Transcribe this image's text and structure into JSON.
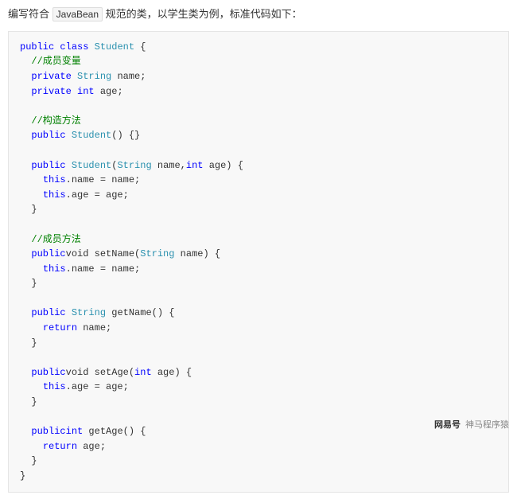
{
  "intro": {
    "prefix": "编写符合",
    "boxed": "JavaBean",
    "suffix": "规范的类，以学生类为例，标准代码如下："
  },
  "code": {
    "lines": [
      [
        {
          "t": "kw-public",
          "v": "public"
        },
        {
          "t": "",
          "v": " "
        },
        {
          "t": "kw-class",
          "v": "class"
        },
        {
          "t": "",
          "v": " "
        },
        {
          "t": "class-name",
          "v": "Student"
        },
        {
          "t": "",
          "v": " {"
        }
      ],
      [
        {
          "t": "",
          "v": "  "
        },
        {
          "t": "comment",
          "v": "//成员变量"
        }
      ],
      [
        {
          "t": "",
          "v": "  "
        },
        {
          "t": "kw-private",
          "v": "private"
        },
        {
          "t": "",
          "v": " "
        },
        {
          "t": "type-string",
          "v": "String"
        },
        {
          "t": "",
          "v": " name;"
        }
      ],
      [
        {
          "t": "",
          "v": "  "
        },
        {
          "t": "kw-private",
          "v": "private"
        },
        {
          "t": "",
          "v": " "
        },
        {
          "t": "kw-int",
          "v": "int"
        },
        {
          "t": "",
          "v": " age;"
        }
      ],
      [],
      [
        {
          "t": "",
          "v": "  "
        },
        {
          "t": "comment",
          "v": "//构造方法"
        }
      ],
      [
        {
          "t": "",
          "v": "  "
        },
        {
          "t": "kw-public",
          "v": "public"
        },
        {
          "t": "",
          "v": " "
        },
        {
          "t": "class-name",
          "v": "Student"
        },
        {
          "t": "",
          "v": "() {}"
        }
      ],
      [],
      [
        {
          "t": "",
          "v": "  "
        },
        {
          "t": "kw-public",
          "v": "public"
        },
        {
          "t": "",
          "v": " "
        },
        {
          "t": "class-name",
          "v": "Student"
        },
        {
          "t": "",
          "v": "("
        },
        {
          "t": "type-string",
          "v": "String"
        },
        {
          "t": "",
          "v": " name,"
        },
        {
          "t": "kw-int",
          "v": "int"
        },
        {
          "t": "",
          "v": " age) {"
        }
      ],
      [
        {
          "t": "",
          "v": "    "
        },
        {
          "t": "kw-this",
          "v": "this"
        },
        {
          "t": "",
          "v": ".name = name;"
        }
      ],
      [
        {
          "t": "",
          "v": "    "
        },
        {
          "t": "kw-this",
          "v": "this"
        },
        {
          "t": "",
          "v": ".age = age;"
        }
      ],
      [
        {
          "t": "",
          "v": "  }"
        }
      ],
      [],
      [
        {
          "t": "",
          "v": "  "
        },
        {
          "t": "comment",
          "v": "//成员方法"
        }
      ],
      [
        {
          "t": "",
          "v": "  "
        },
        {
          "t": "kw-public",
          "v": "public"
        },
        {
          "t": "kw-void",
          "v": "void"
        },
        {
          "t": "",
          "v": " setName("
        },
        {
          "t": "type-string",
          "v": "String"
        },
        {
          "t": "",
          "v": " name) {"
        }
      ],
      [
        {
          "t": "",
          "v": "    "
        },
        {
          "t": "kw-this",
          "v": "this"
        },
        {
          "t": "",
          "v": ".name = name;"
        }
      ],
      [
        {
          "t": "",
          "v": "  }"
        }
      ],
      [],
      [
        {
          "t": "",
          "v": "  "
        },
        {
          "t": "kw-public",
          "v": "public"
        },
        {
          "t": "",
          "v": " "
        },
        {
          "t": "type-string",
          "v": "String"
        },
        {
          "t": "",
          "v": " getName() {"
        }
      ],
      [
        {
          "t": "",
          "v": "    "
        },
        {
          "t": "kw-return",
          "v": "return"
        },
        {
          "t": "",
          "v": " name;"
        }
      ],
      [
        {
          "t": "",
          "v": "  }"
        }
      ],
      [],
      [
        {
          "t": "",
          "v": "  "
        },
        {
          "t": "kw-public",
          "v": "public"
        },
        {
          "t": "kw-void",
          "v": "void"
        },
        {
          "t": "",
          "v": " setAge("
        },
        {
          "t": "kw-int",
          "v": "int"
        },
        {
          "t": "",
          "v": " age) {"
        }
      ],
      [
        {
          "t": "",
          "v": "    "
        },
        {
          "t": "kw-this",
          "v": "this"
        },
        {
          "t": "",
          "v": ".age = age;"
        }
      ],
      [
        {
          "t": "",
          "v": "  }"
        }
      ],
      [],
      [
        {
          "t": "",
          "v": "  "
        },
        {
          "t": "kw-public",
          "v": "public"
        },
        {
          "t": "kw-int",
          "v": "int"
        },
        {
          "t": "",
          "v": " getAge() {"
        }
      ],
      [
        {
          "t": "",
          "v": "    "
        },
        {
          "t": "kw-return",
          "v": "return"
        },
        {
          "t": "",
          "v": " age;"
        }
      ],
      [
        {
          "t": "",
          "v": "  }"
        }
      ],
      [
        {
          "t": "",
          "v": "}"
        }
      ]
    ]
  },
  "watermark": {
    "brand": "网易号",
    "author": "神马程序猿"
  }
}
